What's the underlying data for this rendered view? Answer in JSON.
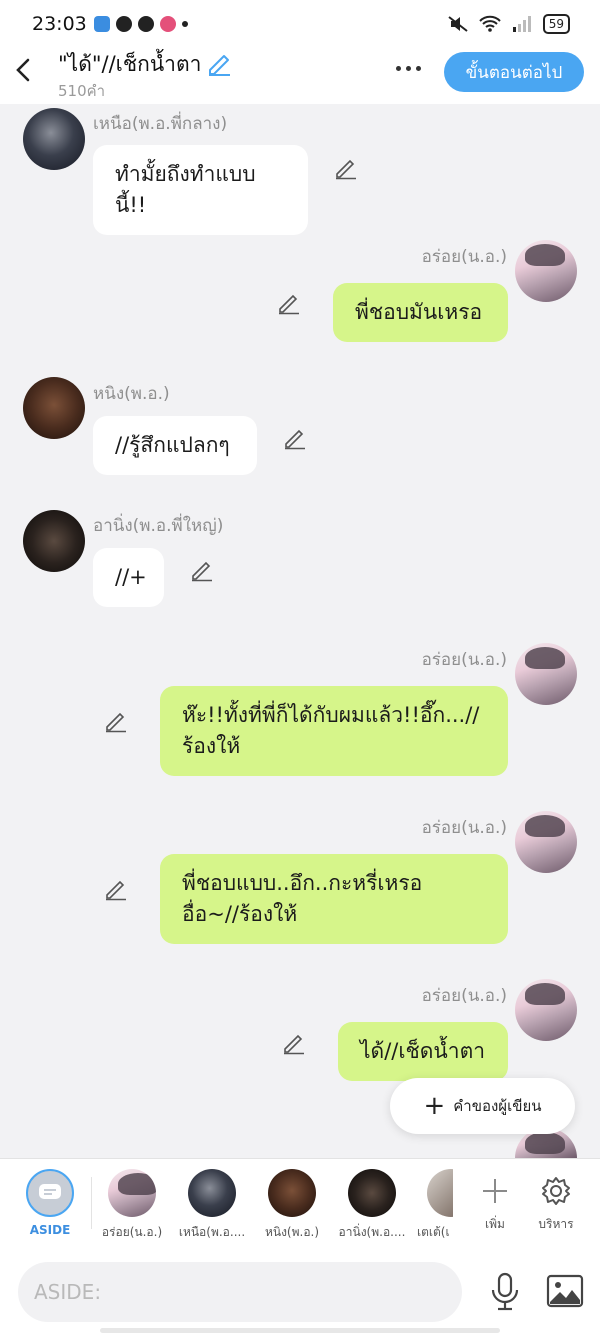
{
  "status_bar": {
    "time": "23:03",
    "battery": "59"
  },
  "header": {
    "title": "\"ได้\"//เช็กน้ำตา",
    "word_count": "510คำ",
    "next_label": "ขั้นตอนต่อไป"
  },
  "messages": [
    {
      "side": "left",
      "name": "เหนือ(พ.อ.พี่กลาง)",
      "lines": [
        "ทำมั้ยถึงทำแบบนี้!!"
      ]
    },
    {
      "side": "right",
      "name": "อร่อย(น.อ.)",
      "lines": [
        "พี่ชอบมันเหรอ"
      ]
    },
    {
      "side": "left",
      "name": "หนิง(พ.อ.)",
      "lines": [
        "//รู้สึกแปลกๆ"
      ]
    },
    {
      "side": "left",
      "name": "อานิ่ง(พ.อ.พี่ใหญ่)",
      "lines": [
        "//+"
      ]
    },
    {
      "side": "right",
      "name": "อร่อย(น.อ.)",
      "lines": [
        "ห๊ะ!!ทั้งที่พี่ก็ได้กับผมแล้ว!!อึ๊ก...//",
        "ร้องให้"
      ]
    },
    {
      "side": "right",
      "name": "อร่อย(น.อ.)",
      "lines": [
        "พี่ชอบแบบ..อึก..กะหรี่เหรอ",
        "อื่อ~//ร้องให้"
      ]
    },
    {
      "side": "right",
      "name": "อร่อย(น.อ.)",
      "lines": [
        "ได้//เช็ดน้ำตา"
      ]
    }
  ],
  "author_note": {
    "label": "คำของผู้เขียน"
  },
  "characters": [
    {
      "label": "ASIDE"
    },
    {
      "label": "อร่อย(น.อ.)"
    },
    {
      "label": "เหนือ(พ.อ...."
    },
    {
      "label": "หนิง(พ.อ.)"
    },
    {
      "label": "อานิ่ง(พ.อ...."
    },
    {
      "label": "เตเต้(เ"
    }
  ],
  "actions": {
    "add_label": "เพิ่ม",
    "manage_label": "บริหาร"
  },
  "input": {
    "placeholder": "ASIDE:"
  },
  "colors": {
    "accent": "#4aa6f2",
    "my_bubble": "#d6f58a",
    "other_bubble": "#ffffff"
  }
}
